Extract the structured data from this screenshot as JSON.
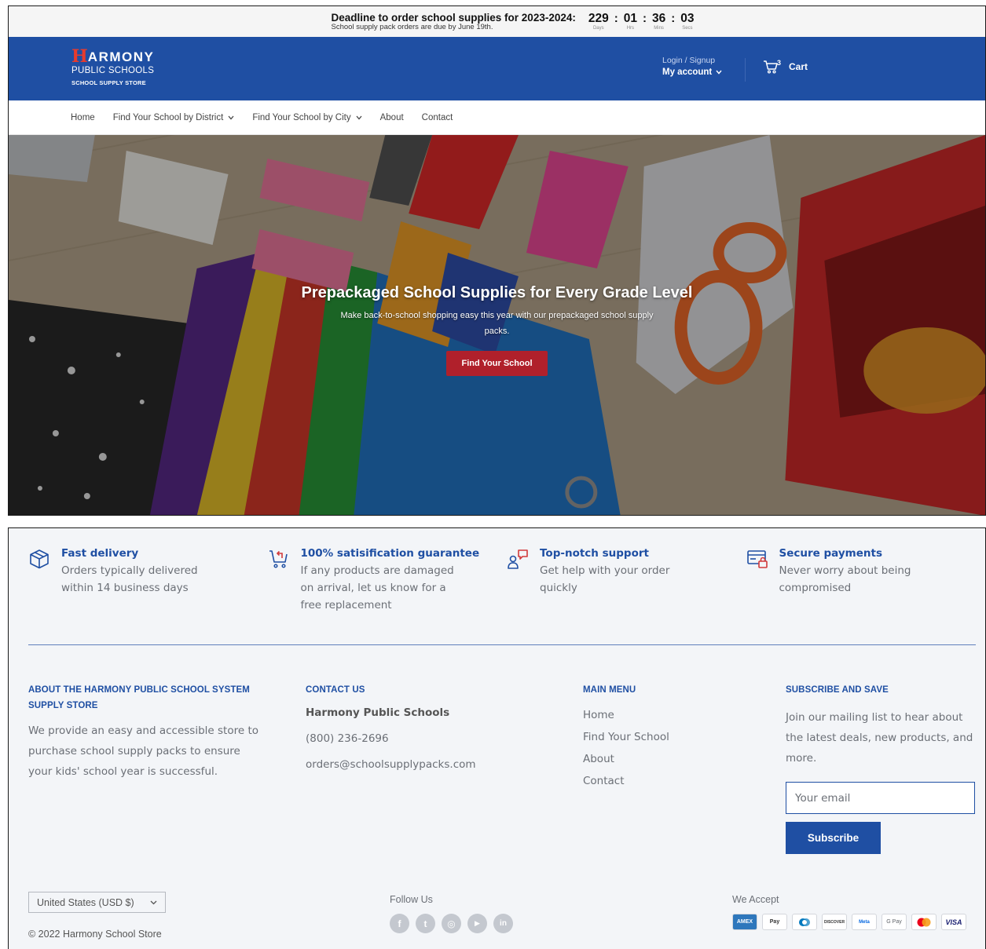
{
  "announcement": {
    "title": "Deadline to order school supplies for 2023-2024:",
    "subtitle": "School supply pack orders are due by June 19th.",
    "countdown": [
      {
        "value": "229",
        "label": "Days"
      },
      {
        "value": "01",
        "label": "Hrs"
      },
      {
        "value": "36",
        "label": "Mins"
      },
      {
        "value": "03",
        "label": "Secs"
      }
    ]
  },
  "header": {
    "logo": {
      "mark": "H",
      "word": "ARMONY",
      "line1": "PUBLIC SCHOOLS",
      "line2": "SCHOOL SUPPLY STORE"
    },
    "login_label": "Login / Signup",
    "account_label": "My account",
    "cart_count": "3",
    "cart_label": "Cart"
  },
  "nav": {
    "items": [
      {
        "label": "Home"
      },
      {
        "label": "Find Your School by District"
      },
      {
        "label": "Find Your School by City"
      },
      {
        "label": "About"
      },
      {
        "label": "Contact"
      }
    ]
  },
  "hero": {
    "title": "Prepackaged School Supplies for Every Grade Level",
    "subtitle": "Make back-to-school shopping easy this year with our prepackaged school supply packs.",
    "button": "Find Your School"
  },
  "features": [
    {
      "icon": "box-icon",
      "title": "Fast delivery",
      "text": "Orders typically delivered within 14 business days"
    },
    {
      "icon": "cart-return-icon",
      "title": "100% satisification guarantee",
      "text": "If any products are damaged on arrival, let us know for a free replacement"
    },
    {
      "icon": "support-icon",
      "title": "Top-notch support",
      "text": "Get help with your order quickly"
    },
    {
      "icon": "secure-payment-icon",
      "title": "Secure payments",
      "text": "Never worry about being compromised"
    }
  ],
  "footer": {
    "about": {
      "title": "ABOUT THE HARMONY PUBLIC SCHOOL SYSTEM SUPPLY STORE",
      "text": "We provide an easy and accessible store to purchase school supply packs to ensure your kids' school year is successful."
    },
    "contact": {
      "title": "CONTACT US",
      "name": "Harmony Public Schools",
      "phone": "(800) 236-2696",
      "email": "orders@schoolsupplypacks.com"
    },
    "menu": {
      "title": "MAIN MENU",
      "links": [
        "Home",
        "Find Your School",
        "About",
        "Contact"
      ]
    },
    "subscribe": {
      "title": "SUBSCRIBE AND SAVE",
      "text": "Join our mailing list to hear about the latest deals, new products, and more.",
      "placeholder": "Your email",
      "button": "Subscribe"
    },
    "currency": "United States (USD $)",
    "copyright": "© 2022 Harmony School Store",
    "follow_label": "Follow Us",
    "social": [
      {
        "icon": "facebook-icon",
        "glyph": "f"
      },
      {
        "icon": "twitter-icon",
        "glyph": "t"
      },
      {
        "icon": "instagram-icon",
        "glyph": "◎"
      },
      {
        "icon": "youtube-icon",
        "glyph": "▶"
      },
      {
        "icon": "linkedin-icon",
        "glyph": "in"
      }
    ],
    "accept_label": "We Accept",
    "payments": [
      {
        "icon": "amex-icon",
        "text": "AMEX"
      },
      {
        "icon": "apple-pay-icon",
        "text": "Pay"
      },
      {
        "icon": "diners-icon",
        "text": ""
      },
      {
        "icon": "discover-icon",
        "text": "DISCOVER"
      },
      {
        "icon": "meta-pay-icon",
        "text": "Meta"
      },
      {
        "icon": "google-pay-icon",
        "text": "G Pay"
      },
      {
        "icon": "mastercard-icon",
        "text": ""
      },
      {
        "icon": "visa-icon",
        "text": "VISA"
      }
    ]
  },
  "colors": {
    "brand_blue": "#1f4fa3",
    "cta_red": "#b0202b",
    "footer_bg": "#f3f5f8"
  }
}
